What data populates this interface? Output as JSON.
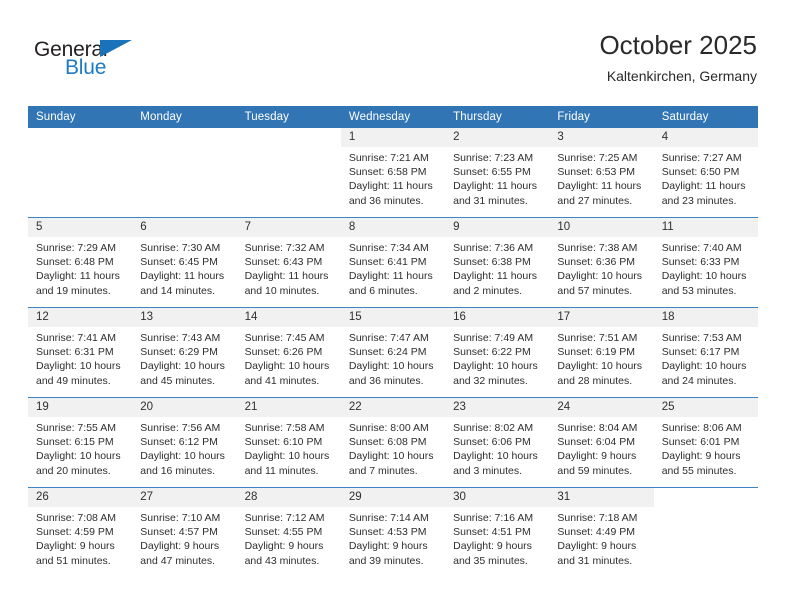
{
  "brand": {
    "word_one": "General",
    "word_two": "Blue",
    "triangle_color": "#1a72b8",
    "blue_color": "#1c7bc4"
  },
  "header": {
    "title": "October 2025",
    "subtitle": "Kaltenkirchen, Germany"
  },
  "theme": {
    "header_band": "#3175b4",
    "row_divider": "#3d84c4",
    "daynum_bg": "#f1f1f1",
    "text": "#2e2e2e"
  },
  "labels": {
    "sunrise_prefix": "Sunrise:",
    "sunset_prefix": "Sunset:",
    "daylight_prefix": "Daylight:"
  },
  "weekdays": [
    "Sunday",
    "Monday",
    "Tuesday",
    "Wednesday",
    "Thursday",
    "Friday",
    "Saturday"
  ],
  "weeks": [
    [
      {
        "blank": true
      },
      {
        "blank": true
      },
      {
        "blank": true
      },
      {
        "day": "1",
        "sunrise": "Sunrise: 7:21 AM",
        "sunset": "Sunset: 6:58 PM",
        "daylight_1": "Daylight: 11 hours",
        "daylight_2": "and 36 minutes."
      },
      {
        "day": "2",
        "sunrise": "Sunrise: 7:23 AM",
        "sunset": "Sunset: 6:55 PM",
        "daylight_1": "Daylight: 11 hours",
        "daylight_2": "and 31 minutes."
      },
      {
        "day": "3",
        "sunrise": "Sunrise: 7:25 AM",
        "sunset": "Sunset: 6:53 PM",
        "daylight_1": "Daylight: 11 hours",
        "daylight_2": "and 27 minutes."
      },
      {
        "day": "4",
        "sunrise": "Sunrise: 7:27 AM",
        "sunset": "Sunset: 6:50 PM",
        "daylight_1": "Daylight: 11 hours",
        "daylight_2": "and 23 minutes."
      }
    ],
    [
      {
        "day": "5",
        "sunrise": "Sunrise: 7:29 AM",
        "sunset": "Sunset: 6:48 PM",
        "daylight_1": "Daylight: 11 hours",
        "daylight_2": "and 19 minutes."
      },
      {
        "day": "6",
        "sunrise": "Sunrise: 7:30 AM",
        "sunset": "Sunset: 6:45 PM",
        "daylight_1": "Daylight: 11 hours",
        "daylight_2": "and 14 minutes."
      },
      {
        "day": "7",
        "sunrise": "Sunrise: 7:32 AM",
        "sunset": "Sunset: 6:43 PM",
        "daylight_1": "Daylight: 11 hours",
        "daylight_2": "and 10 minutes."
      },
      {
        "day": "8",
        "sunrise": "Sunrise: 7:34 AM",
        "sunset": "Sunset: 6:41 PM",
        "daylight_1": "Daylight: 11 hours",
        "daylight_2": "and 6 minutes."
      },
      {
        "day": "9",
        "sunrise": "Sunrise: 7:36 AM",
        "sunset": "Sunset: 6:38 PM",
        "daylight_1": "Daylight: 11 hours",
        "daylight_2": "and 2 minutes."
      },
      {
        "day": "10",
        "sunrise": "Sunrise: 7:38 AM",
        "sunset": "Sunset: 6:36 PM",
        "daylight_1": "Daylight: 10 hours",
        "daylight_2": "and 57 minutes."
      },
      {
        "day": "11",
        "sunrise": "Sunrise: 7:40 AM",
        "sunset": "Sunset: 6:33 PM",
        "daylight_1": "Daylight: 10 hours",
        "daylight_2": "and 53 minutes."
      }
    ],
    [
      {
        "day": "12",
        "sunrise": "Sunrise: 7:41 AM",
        "sunset": "Sunset: 6:31 PM",
        "daylight_1": "Daylight: 10 hours",
        "daylight_2": "and 49 minutes."
      },
      {
        "day": "13",
        "sunrise": "Sunrise: 7:43 AM",
        "sunset": "Sunset: 6:29 PM",
        "daylight_1": "Daylight: 10 hours",
        "daylight_2": "and 45 minutes."
      },
      {
        "day": "14",
        "sunrise": "Sunrise: 7:45 AM",
        "sunset": "Sunset: 6:26 PM",
        "daylight_1": "Daylight: 10 hours",
        "daylight_2": "and 41 minutes."
      },
      {
        "day": "15",
        "sunrise": "Sunrise: 7:47 AM",
        "sunset": "Sunset: 6:24 PM",
        "daylight_1": "Daylight: 10 hours",
        "daylight_2": "and 36 minutes."
      },
      {
        "day": "16",
        "sunrise": "Sunrise: 7:49 AM",
        "sunset": "Sunset: 6:22 PM",
        "daylight_1": "Daylight: 10 hours",
        "daylight_2": "and 32 minutes."
      },
      {
        "day": "17",
        "sunrise": "Sunrise: 7:51 AM",
        "sunset": "Sunset: 6:19 PM",
        "daylight_1": "Daylight: 10 hours",
        "daylight_2": "and 28 minutes."
      },
      {
        "day": "18",
        "sunrise": "Sunrise: 7:53 AM",
        "sunset": "Sunset: 6:17 PM",
        "daylight_1": "Daylight: 10 hours",
        "daylight_2": "and 24 minutes."
      }
    ],
    [
      {
        "day": "19",
        "sunrise": "Sunrise: 7:55 AM",
        "sunset": "Sunset: 6:15 PM",
        "daylight_1": "Daylight: 10 hours",
        "daylight_2": "and 20 minutes."
      },
      {
        "day": "20",
        "sunrise": "Sunrise: 7:56 AM",
        "sunset": "Sunset: 6:12 PM",
        "daylight_1": "Daylight: 10 hours",
        "daylight_2": "and 16 minutes."
      },
      {
        "day": "21",
        "sunrise": "Sunrise: 7:58 AM",
        "sunset": "Sunset: 6:10 PM",
        "daylight_1": "Daylight: 10 hours",
        "daylight_2": "and 11 minutes."
      },
      {
        "day": "22",
        "sunrise": "Sunrise: 8:00 AM",
        "sunset": "Sunset: 6:08 PM",
        "daylight_1": "Daylight: 10 hours",
        "daylight_2": "and 7 minutes."
      },
      {
        "day": "23",
        "sunrise": "Sunrise: 8:02 AM",
        "sunset": "Sunset: 6:06 PM",
        "daylight_1": "Daylight: 10 hours",
        "daylight_2": "and 3 minutes."
      },
      {
        "day": "24",
        "sunrise": "Sunrise: 8:04 AM",
        "sunset": "Sunset: 6:04 PM",
        "daylight_1": "Daylight: 9 hours",
        "daylight_2": "and 59 minutes."
      },
      {
        "day": "25",
        "sunrise": "Sunrise: 8:06 AM",
        "sunset": "Sunset: 6:01 PM",
        "daylight_1": "Daylight: 9 hours",
        "daylight_2": "and 55 minutes."
      }
    ],
    [
      {
        "day": "26",
        "sunrise": "Sunrise: 7:08 AM",
        "sunset": "Sunset: 4:59 PM",
        "daylight_1": "Daylight: 9 hours",
        "daylight_2": "and 51 minutes."
      },
      {
        "day": "27",
        "sunrise": "Sunrise: 7:10 AM",
        "sunset": "Sunset: 4:57 PM",
        "daylight_1": "Daylight: 9 hours",
        "daylight_2": "and 47 minutes."
      },
      {
        "day": "28",
        "sunrise": "Sunrise: 7:12 AM",
        "sunset": "Sunset: 4:55 PM",
        "daylight_1": "Daylight: 9 hours",
        "daylight_2": "and 43 minutes."
      },
      {
        "day": "29",
        "sunrise": "Sunrise: 7:14 AM",
        "sunset": "Sunset: 4:53 PM",
        "daylight_1": "Daylight: 9 hours",
        "daylight_2": "and 39 minutes."
      },
      {
        "day": "30",
        "sunrise": "Sunrise: 7:16 AM",
        "sunset": "Sunset: 4:51 PM",
        "daylight_1": "Daylight: 9 hours",
        "daylight_2": "and 35 minutes."
      },
      {
        "day": "31",
        "sunrise": "Sunrise: 7:18 AM",
        "sunset": "Sunset: 4:49 PM",
        "daylight_1": "Daylight: 9 hours",
        "daylight_2": "and 31 minutes."
      },
      {
        "blank": true
      }
    ]
  ]
}
